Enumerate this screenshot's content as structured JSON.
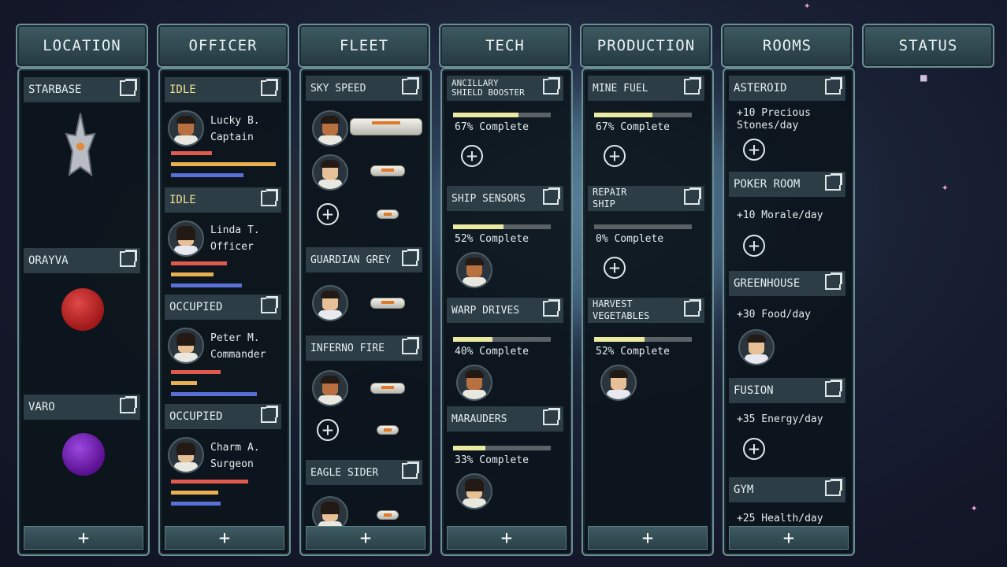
{
  "columns": {
    "location": {
      "title": "LOCATION"
    },
    "officer": {
      "title": "OFFICER"
    },
    "fleet": {
      "title": "FLEET"
    },
    "tech": {
      "title": "TECH"
    },
    "production": {
      "title": "PRODUCTION"
    },
    "rooms": {
      "title": "ROOMS"
    },
    "status": {
      "title": "STATUS"
    }
  },
  "add_label": "+",
  "locations": [
    {
      "name": "STARBASE"
    },
    {
      "name": "ORAYVA",
      "planet_color": "#c03030"
    },
    {
      "name": "VARO",
      "planet_color": "#7a28b8"
    }
  ],
  "officers": [
    {
      "status": "IDLE",
      "name": "Lucky B.",
      "role": "Captain",
      "stats": [
        0.38,
        0.98,
        0.68
      ]
    },
    {
      "status": "IDLE",
      "name": "Linda T.",
      "role": "Officer",
      "stats": [
        0.52,
        0.4,
        0.66
      ]
    },
    {
      "status": "OCCUPIED",
      "name": "Peter M.",
      "role": "Commander",
      "stats": [
        0.46,
        0.24,
        0.8
      ]
    },
    {
      "status": "OCCUPIED",
      "name": "Charm A.",
      "role": "Surgeon",
      "stats": [
        0.72,
        0.44,
        0.46
      ]
    }
  ],
  "fleets": [
    {
      "name": "SKY SPEED"
    },
    {
      "name": "GUARDIAN GREY"
    },
    {
      "name": "INFERNO FIRE"
    },
    {
      "name": "EAGLE SIDER"
    }
  ],
  "tech": [
    {
      "name_line1": "ANCILLARY",
      "name_line2": "SHIELD BOOSTER",
      "progress": "67% Complete",
      "pct": 0.67
    },
    {
      "name": "SHIP SENSORS",
      "progress": "52% Complete",
      "pct": 0.52
    },
    {
      "name": "WARP DRIVES",
      "progress": "40% Complete",
      "pct": 0.4
    },
    {
      "name": "MARAUDERS",
      "progress": "33% Complete",
      "pct": 0.33
    }
  ],
  "production": [
    {
      "name": "MINE FUEL",
      "progress": "67% Complete",
      "pct": 0.6
    },
    {
      "name_line1": "REPAIR",
      "name_line2": "SHIP",
      "progress": "0% Complete",
      "pct": 0
    },
    {
      "name_line1": "HARVEST",
      "name_line2": "VEGETABLES",
      "progress": "52% Complete",
      "pct": 0.52
    }
  ],
  "rooms": [
    {
      "name": "ASTEROID",
      "effect_line1": "+10 Precious",
      "effect_line2": "Stones/day"
    },
    {
      "name": "POKER ROOM",
      "effect": "+10 Morale/day"
    },
    {
      "name": "GREENHOUSE",
      "effect": "+30 Food/day"
    },
    {
      "name": "FUSION",
      "effect": "+35 Energy/day"
    },
    {
      "name": "GYM",
      "effect": "+25 Health/day"
    }
  ],
  "colors": {
    "bar_red": "#e05a4e",
    "bar_yellow": "#e8b050",
    "bar_blue": "#5a70d8",
    "progress_fill": "#eaeaa0",
    "label_idle": "#f0e090"
  }
}
